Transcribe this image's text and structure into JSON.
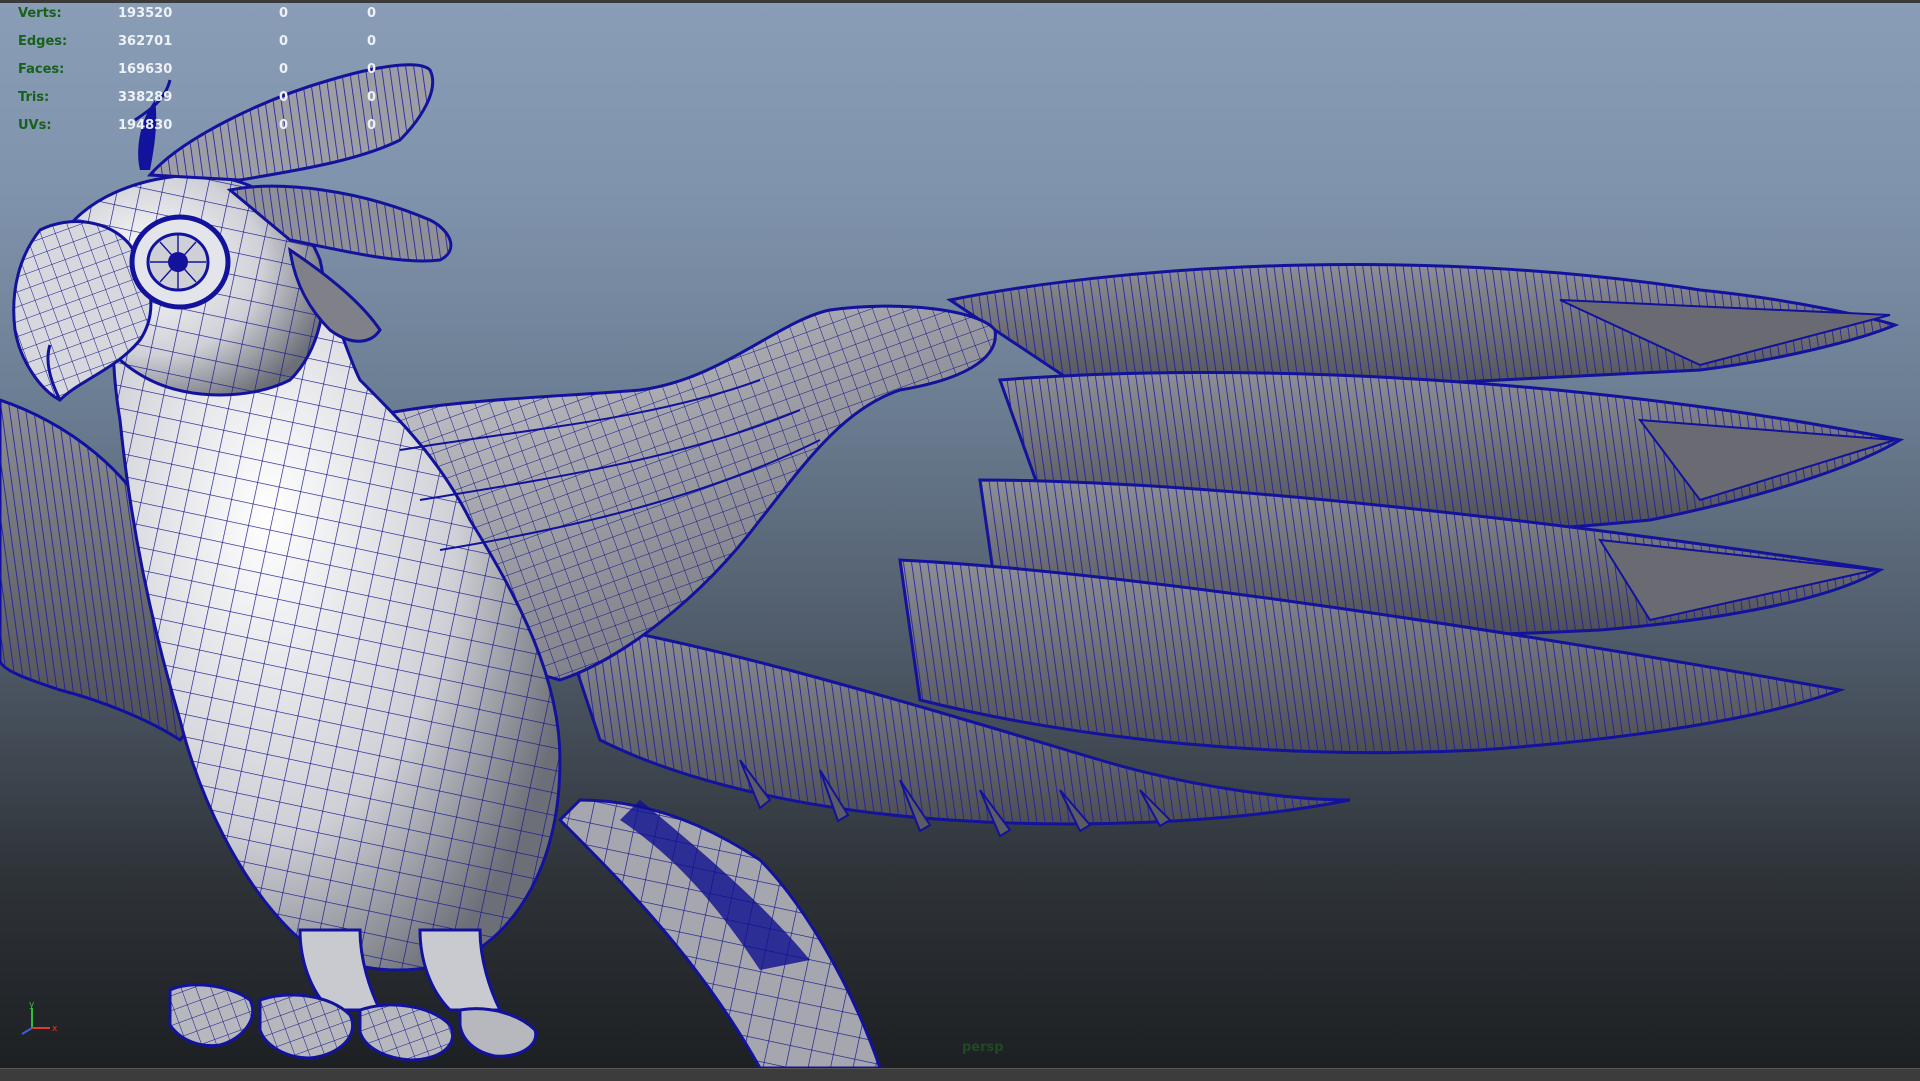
{
  "hud": {
    "rows": [
      {
        "label": "Verts:",
        "v1": "193520",
        "v2": "0",
        "v3": "0"
      },
      {
        "label": "Edges:",
        "v1": "362701",
        "v2": "0",
        "v3": "0"
      },
      {
        "label": "Faces:",
        "v1": "169630",
        "v2": "0",
        "v3": "0"
      },
      {
        "label": "Tris:",
        "v1": "338289",
        "v2": "0",
        "v3": "0"
      },
      {
        "label": "UVs:",
        "v1": "194830",
        "v2": "0",
        "v3": "0"
      }
    ]
  },
  "viewport": {
    "camera_label": "persp",
    "wire_color": "#0a0a8a",
    "axis": {
      "y": "y",
      "x": "x"
    }
  }
}
